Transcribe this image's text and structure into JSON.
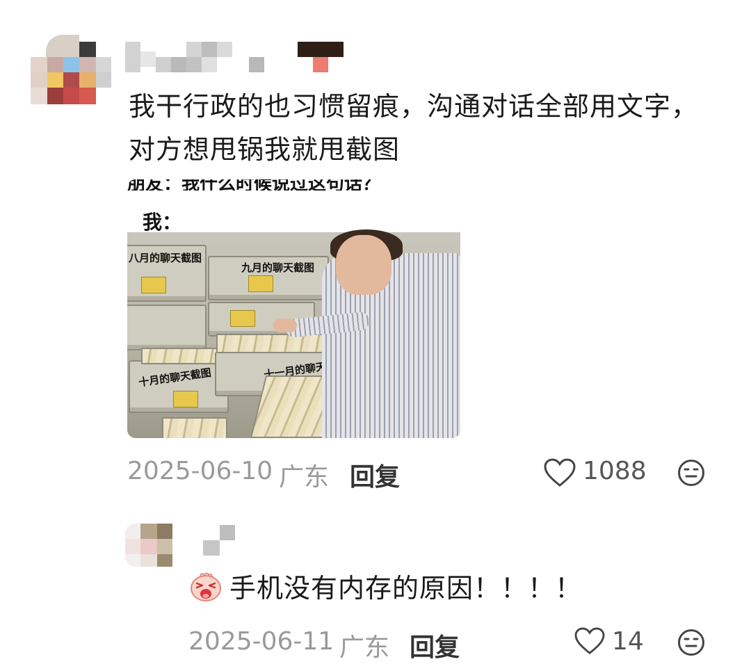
{
  "comment": {
    "text": "我干行政的也习惯留痕，沟通对话全部用文字，对方想甩锅我就甩截图",
    "image": {
      "cut_off_text": "朋友：我什么时候说过这句话？",
      "caption": "我：",
      "drawer_labels": [
        "八月的聊天截图",
        "九月的聊天截图",
        "十月的聊天截图",
        "十一月的聊天截图"
      ]
    },
    "date": "2025-06-10",
    "location": "广东",
    "reply_label": "回复",
    "likes": "1088"
  },
  "reply": {
    "text": "手机没有内存的原因！！！！",
    "date": "2025-06-11",
    "location": "广东",
    "reply_label": "回复",
    "likes": "14"
  },
  "icons": {
    "like": "heart-outline-icon",
    "emoji": "neutral-face-icon",
    "reply_emoji": "crying-laughing-emoji-icon"
  },
  "colors": {
    "meta": "#9a9a9a",
    "text": "#1a1a1a"
  }
}
